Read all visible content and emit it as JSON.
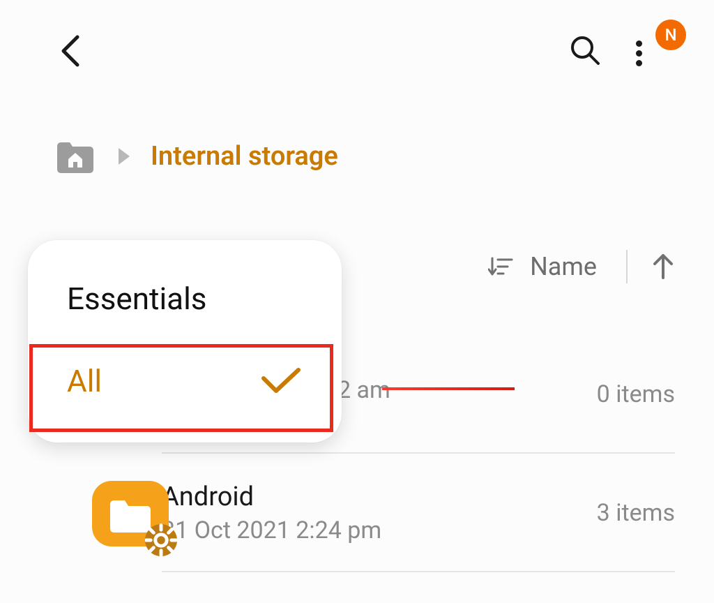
{
  "avatar": {
    "initial": "N"
  },
  "breadcrumb": {
    "current": "Internal storage"
  },
  "sort": {
    "label": "Name"
  },
  "dropdown": {
    "item_essentials": "Essentials",
    "item_all": "All"
  },
  "rows": {
    "r1": {
      "partial_time": "2 am",
      "count": "0 items"
    },
    "r2": {
      "title": "Android",
      "subtitle": "31 Oct 2021 2:24 pm",
      "count": "3 items"
    }
  }
}
